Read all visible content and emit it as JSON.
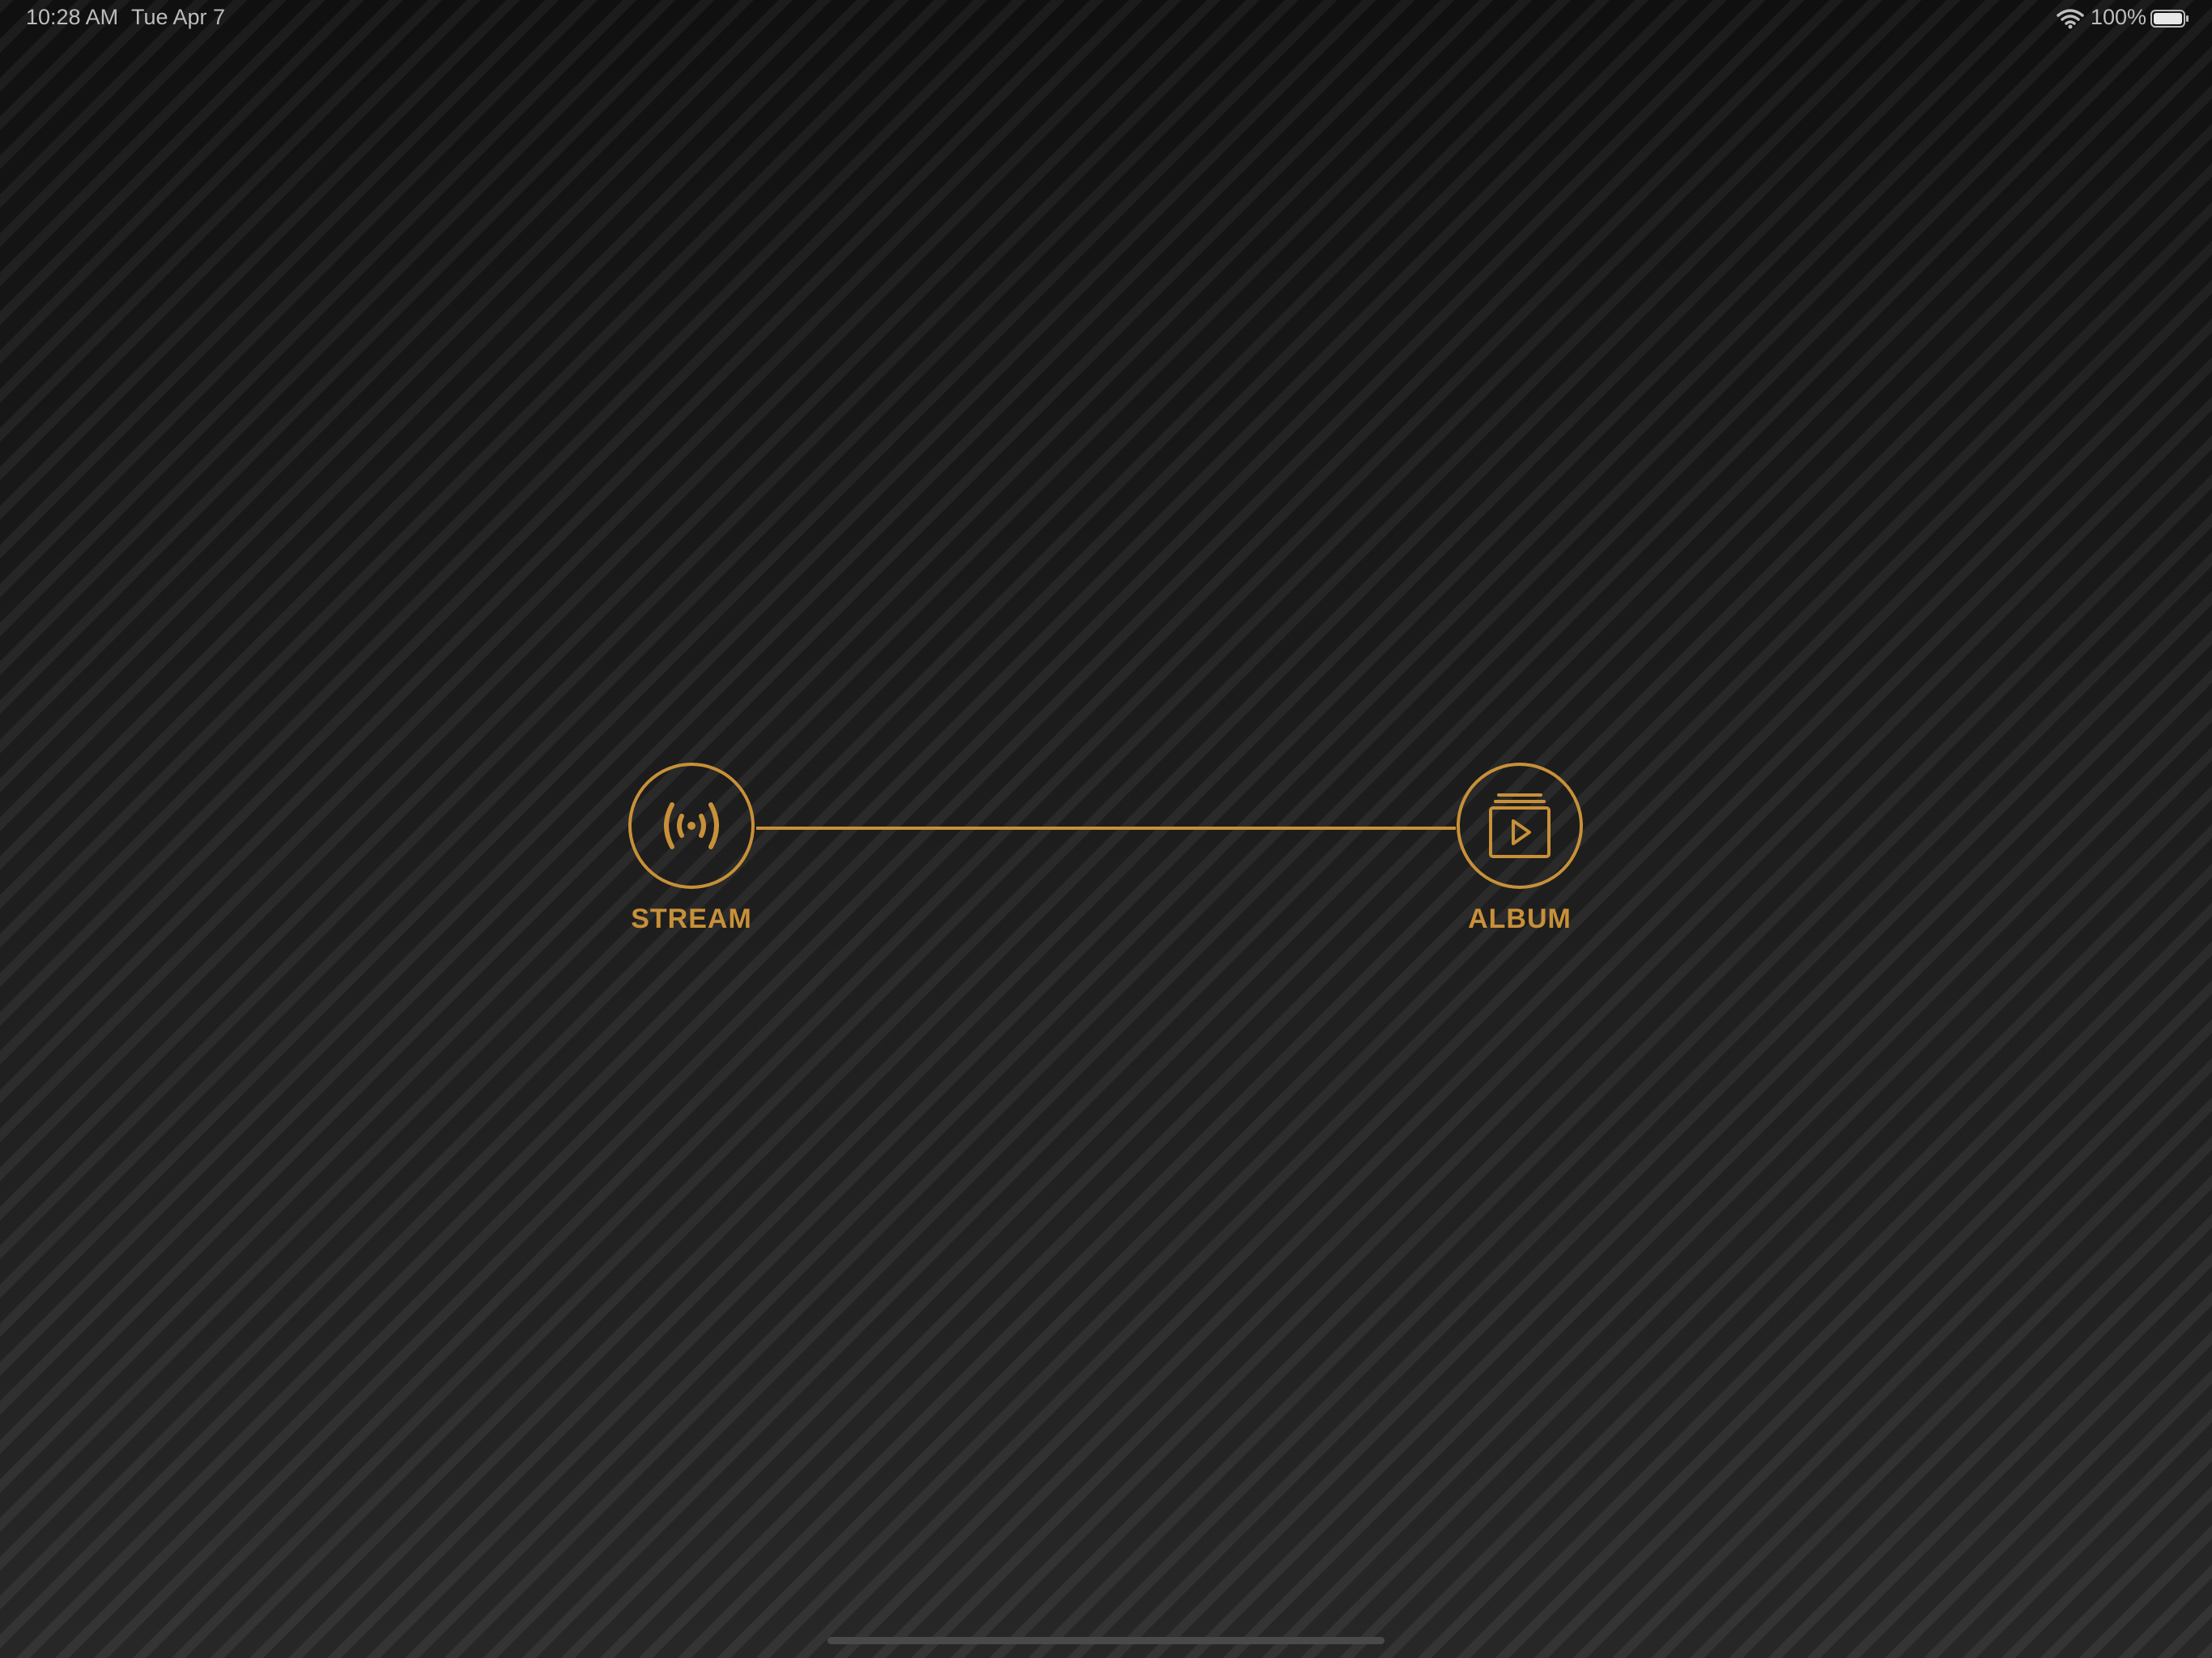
{
  "status_bar": {
    "time": "10:28 AM",
    "date": "Tue Apr 7",
    "battery_percent": "100%",
    "wifi_icon": "wifi-icon",
    "battery_icon": "battery-full-icon"
  },
  "nodes": {
    "stream": {
      "label": "STREAM",
      "icon": "broadcast-icon"
    },
    "album": {
      "label": "ALBUM",
      "icon": "album-play-icon"
    }
  },
  "colors": {
    "accent": "#c89038",
    "text_status": "#bdbdbd",
    "background": "#1a1a1a"
  }
}
